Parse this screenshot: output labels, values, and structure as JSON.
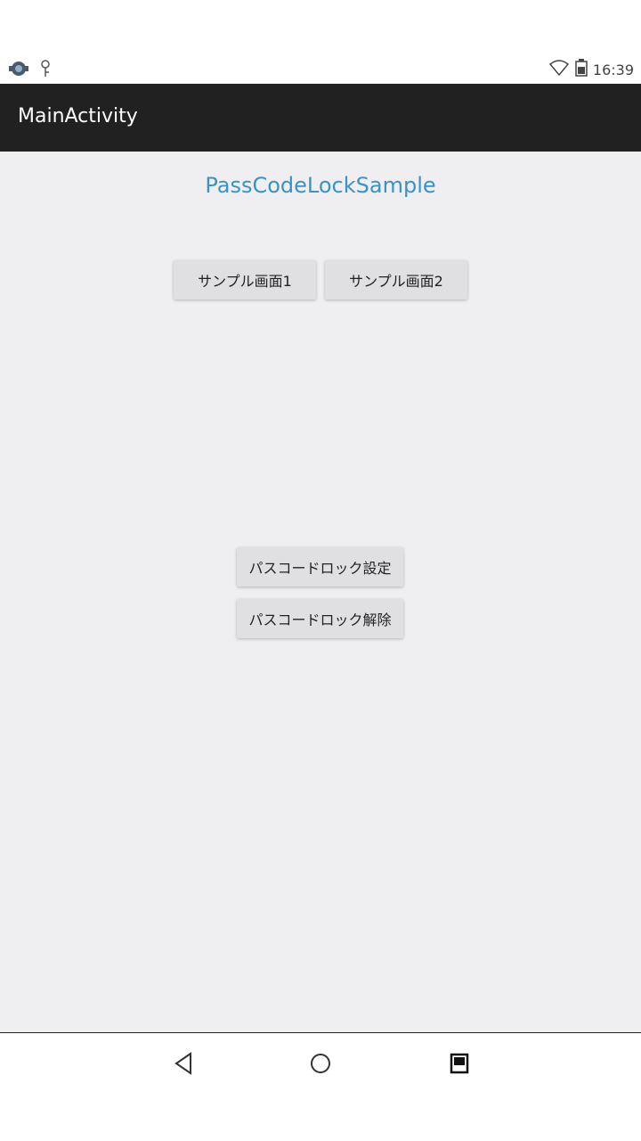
{
  "status_bar": {
    "time": "16:39",
    "icons": [
      "notification-icon",
      "debug-icon",
      "wifi-icon",
      "battery-icon"
    ]
  },
  "app_bar": {
    "title": "MainActivity"
  },
  "main": {
    "header": "PassCodeLockSample",
    "sample1_label": "サンプル画面1",
    "sample2_label": "サンプル画面2",
    "passcode_set_label": "パスコードロック設定",
    "passcode_release_label": "パスコードロック解除"
  },
  "nav_bar": {
    "icons": [
      "back-icon",
      "home-icon",
      "recents-icon"
    ]
  },
  "colors": {
    "app_bar": "#212121",
    "header_text": "#3a93c6",
    "background": "#efeef0",
    "button": "#e0dfe1"
  }
}
